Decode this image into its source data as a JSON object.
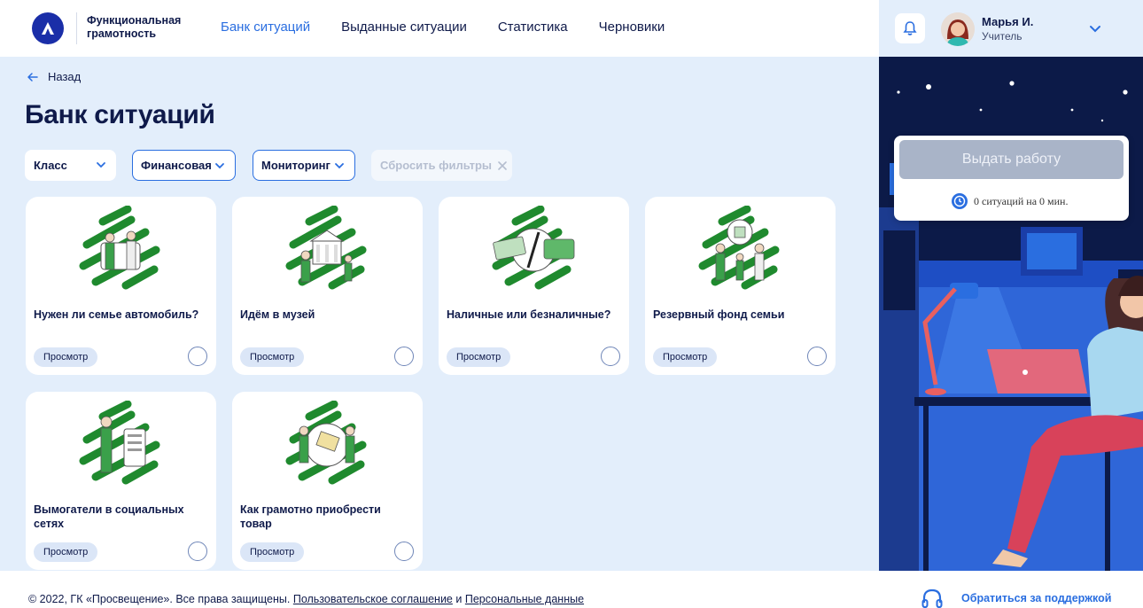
{
  "brand": {
    "name": "Функциональная грамотность"
  },
  "nav": [
    {
      "label": "Банк ситуаций",
      "active": true
    },
    {
      "label": "Выданные ситуации",
      "active": false
    },
    {
      "label": "Статистика",
      "active": false
    },
    {
      "label": "Черновики",
      "active": false
    }
  ],
  "user": {
    "name": "Марья И.",
    "role": "Учитель"
  },
  "back": {
    "label": "Назад"
  },
  "page_title": "Банк ситуаций",
  "filters": [
    {
      "label": "Класс",
      "selected": false
    },
    {
      "label": "Финансовая",
      "selected": true
    },
    {
      "label": "Мониторинг",
      "selected": true
    }
  ],
  "reset_filters": "Сбросить фильтры",
  "cards": [
    {
      "title": "Нужен ли семье автомобиль?",
      "button": "Просмотр",
      "icon": "family-car-illustration"
    },
    {
      "title": "Идём в музей",
      "button": "Просмотр",
      "icon": "museum-illustration"
    },
    {
      "title": "Наличные или безналичные?",
      "button": "Просмотр",
      "icon": "cash-card-illustration"
    },
    {
      "title": "Резервный фонд семьи",
      "button": "Просмотр",
      "icon": "family-fund-illustration"
    },
    {
      "title": "Вымогатели в социальных сетях",
      "button": "Просмотр",
      "icon": "social-extortion-illustration"
    },
    {
      "title": "Как грамотно приобрести товар",
      "button": "Просмотр",
      "icon": "purchase-illustration"
    }
  ],
  "issue_panel": {
    "button": "Выдать работу",
    "info": "0 ситуаций на 0 мин."
  },
  "footer": {
    "copyright": "© 2022, ГК «Просвещение». Все права защищены.",
    "agreement": "Пользовательское соглашение",
    "and": "и",
    "personal": "Персональные данные",
    "support": "Обратиться за поддержкой"
  },
  "colors": {
    "accent": "#2a6ee0",
    "brand": "#1a2ea8",
    "illustration_green": "#1f8a2e",
    "background": "#e3eefb"
  }
}
